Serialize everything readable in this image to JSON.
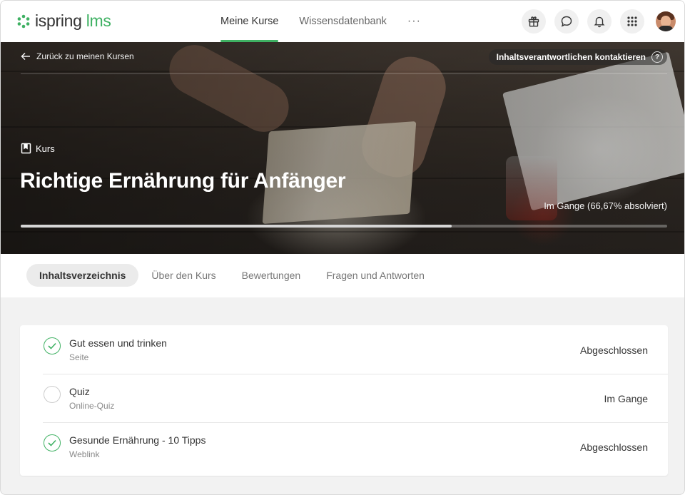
{
  "app": {
    "logo_word": "ispring",
    "logo_suffix": "lms",
    "brand_color": "#3fb163"
  },
  "nav": {
    "items": [
      {
        "label": "Meine Kurse",
        "active": true
      },
      {
        "label": "Wissensdatenbank",
        "active": false
      }
    ],
    "more_label": "···"
  },
  "header_icons": [
    "gift-icon",
    "chat-icon",
    "bell-icon",
    "apps-grid-icon"
  ],
  "hero": {
    "back_label": "Zurück zu meinen Kursen",
    "contact_label": "Inhaltsverantwortlichen kontaktieren",
    "help_symbol": "?",
    "type_label": "Kurs",
    "title": "Richtige Ernährung für Anfänger",
    "progress_text": "Im Gange (66,67% absolviert)",
    "progress_fraction": 0.6667
  },
  "tabs": [
    {
      "label": "Inhaltsverzeichnis",
      "active": true
    },
    {
      "label": "Über den Kurs",
      "active": false
    },
    {
      "label": "Bewertungen",
      "active": false
    },
    {
      "label": "Fragen und Antworten",
      "active": false
    }
  ],
  "content": {
    "items": [
      {
        "title": "Gut essen und trinken",
        "type": "Seite",
        "state": "Abgeschlossen",
        "completed": true
      },
      {
        "title": "Quiz",
        "type": "Online-Quiz",
        "state": "Im Gange",
        "completed": false
      },
      {
        "title": "Gesunde Ernährung - 10 Tipps",
        "type": "Weblink",
        "state": "Abgeschlossen",
        "completed": true
      }
    ]
  }
}
